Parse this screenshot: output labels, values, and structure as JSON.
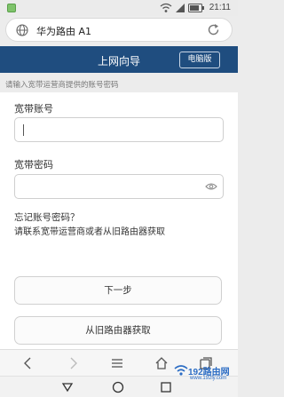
{
  "status_bar": {
    "time": "21:11",
    "icons": [
      "notification-icon",
      "wifi-icon",
      "signal-icon",
      "battery-icon"
    ]
  },
  "address_bar": {
    "title": "华为路由 A1",
    "icons": [
      "globe-icon",
      "refresh-icon"
    ]
  },
  "header": {
    "title": "上网向导",
    "desktop_button": "电脑版"
  },
  "hint": "请输入宽带运营商提供的账号密码",
  "form": {
    "account_label": "宽带账号",
    "account_value": "",
    "password_label": "宽带密码",
    "password_value": ""
  },
  "help": {
    "title": "忘记账号密码？",
    "text": "请联系宽带运营商或者从旧路由器获取"
  },
  "buttons": {
    "next": "下一步",
    "from_old_router": "从旧路由器获取"
  },
  "browser_toolbar": {
    "icons": [
      "back-icon",
      "forward-icon",
      "menu-icon",
      "home-icon",
      "tabs-icon"
    ]
  },
  "nav_bar": {
    "icons": [
      "nav-back-icon",
      "nav-home-icon",
      "nav-recents-icon"
    ]
  },
  "watermark": {
    "text": "192路由网",
    "sub": "www.192ly.com"
  },
  "colors": {
    "header": "#1f4d7f",
    "background": "#ececec",
    "panel": "#ffffff",
    "watermark": "#2b6cc4"
  }
}
